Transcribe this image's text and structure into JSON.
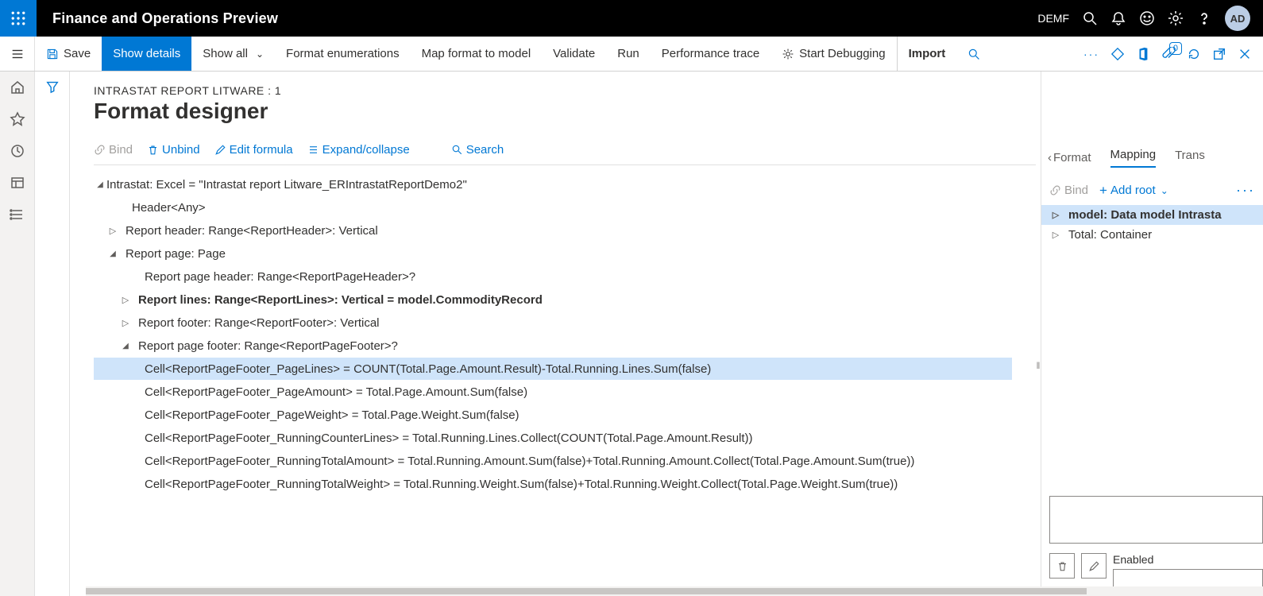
{
  "header": {
    "app_title": "Finance and Operations Preview",
    "company": "DEMF",
    "avatar": "AD"
  },
  "actionbar": {
    "save": "Save",
    "show_details": "Show details",
    "show_all": "Show all",
    "format_enum": "Format enumerations",
    "map_format": "Map format to model",
    "validate": "Validate",
    "run": "Run",
    "perf_trace": "Performance trace",
    "start_debug": "Start Debugging",
    "import": "Import",
    "badge_count": "0"
  },
  "page": {
    "breadcrumb": "INTRASTAT REPORT LITWARE : 1",
    "title": "Format designer"
  },
  "toolbar": {
    "bind": "Bind",
    "unbind": "Unbind",
    "edit": "Edit formula",
    "expand": "Expand/collapse",
    "search": "Search"
  },
  "tree": {
    "n0": "Intrastat: Excel = \"Intrastat report Litware_ERIntrastatReportDemo2\"",
    "n1": "Header<Any>",
    "n2": "Report header: Range<ReportHeader>: Vertical",
    "n3": "Report page: Page",
    "n4": "Report page header: Range<ReportPageHeader>?",
    "n5": "Report lines: Range<ReportLines>: Vertical = model.CommodityRecord",
    "n6": "Report footer: Range<ReportFooter>: Vertical",
    "n7": "Report page footer: Range<ReportPageFooter>?",
    "n8": "Cell<ReportPageFooter_PageLines> = COUNT(Total.Page.Amount.Result)-Total.Running.Lines.Sum(false)",
    "n9": "Cell<ReportPageFooter_PageAmount> = Total.Page.Amount.Sum(false)",
    "n10": "Cell<ReportPageFooter_PageWeight> = Total.Page.Weight.Sum(false)",
    "n11": "Cell<ReportPageFooter_RunningCounterLines> = Total.Running.Lines.Collect(COUNT(Total.Page.Amount.Result))",
    "n12": "Cell<ReportPageFooter_RunningTotalAmount> = Total.Running.Amount.Sum(false)+Total.Running.Amount.Collect(Total.Page.Amount.Sum(true))",
    "n13": "Cell<ReportPageFooter_RunningTotalWeight> = Total.Running.Weight.Sum(false)+Total.Running.Weight.Collect(Total.Page.Weight.Sum(true))"
  },
  "right": {
    "tab_format": "Format",
    "tab_mapping": "Mapping",
    "tab_trans": "Trans",
    "bind": "Bind",
    "add_root": "Add root",
    "node_model": "model: Data model Intrasta",
    "node_total": "Total: Container",
    "enabled": "Enabled"
  }
}
